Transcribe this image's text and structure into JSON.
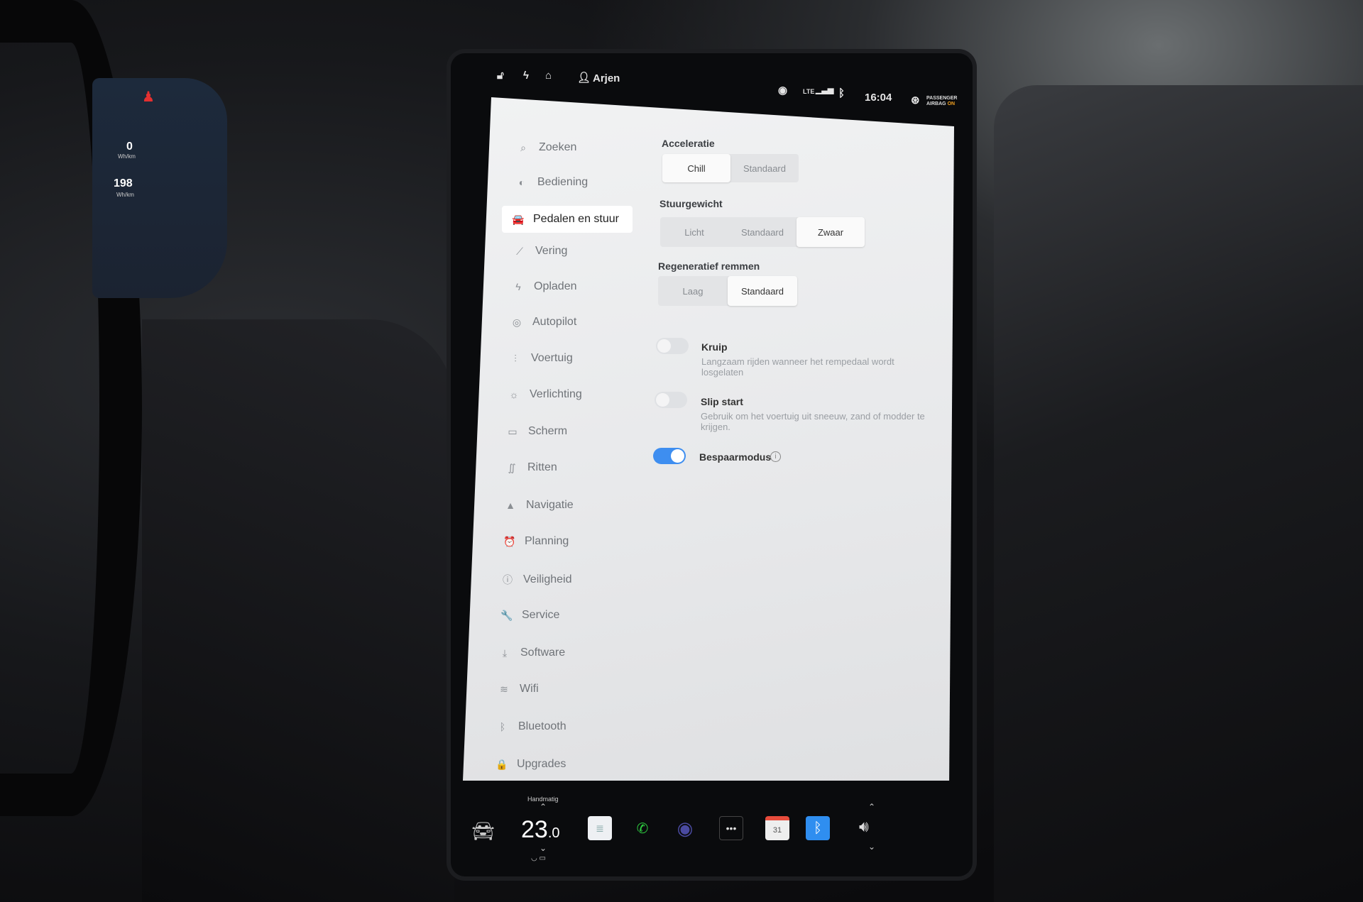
{
  "cluster": {
    "consumption_value": "0",
    "consumption_unit": "Wh/km",
    "avg_value": "198",
    "avg_unit": "Wh/km"
  },
  "status_bar": {
    "user": "Arjen",
    "network": "LTE",
    "time": "16:04",
    "airbag_line1": "PASSENGER",
    "airbag_line2": "AIRBAG",
    "airbag_state": "ON",
    "icons": [
      "lock-open-icon",
      "bolt-icon",
      "homelink-icon",
      "user-icon",
      "record-icon",
      "signal-icon",
      "bluetooth-icon",
      "airbag-icon"
    ]
  },
  "sidebar": {
    "items": [
      {
        "label": "Zoeken",
        "icon": "⌕"
      },
      {
        "label": "Bediening",
        "icon": "◐"
      },
      {
        "label": "Pedalen en stuur",
        "icon": "🚘",
        "selected": true
      },
      {
        "label": "Vering",
        "icon": "⟋"
      },
      {
        "label": "Opladen",
        "icon": "ϟ"
      },
      {
        "label": "Autopilot",
        "icon": "◎"
      },
      {
        "label": "Voertuig",
        "icon": "⫶"
      },
      {
        "label": "Verlichting",
        "icon": "☼"
      },
      {
        "label": "Scherm",
        "icon": "▭"
      },
      {
        "label": "Ritten",
        "icon": "∬"
      },
      {
        "label": "Navigatie",
        "icon": "▲"
      },
      {
        "label": "Planning",
        "icon": "⏰"
      },
      {
        "label": "Veiligheid",
        "icon": "ⓘ"
      },
      {
        "label": "Service",
        "icon": "🔧"
      },
      {
        "label": "Software",
        "icon": "⤓"
      },
      {
        "label": "Wifi",
        "icon": "≋"
      },
      {
        "label": "Bluetooth",
        "icon": "ᛒ"
      },
      {
        "label": "Upgrades",
        "icon": "🔒"
      }
    ]
  },
  "settings": {
    "acceleratie": {
      "label": "Acceleratie",
      "options": [
        "Chill",
        "Standaard"
      ],
      "selected": "Chill"
    },
    "stuurgewicht": {
      "label": "Stuurgewicht",
      "options": [
        "Licht",
        "Standaard",
        "Zwaar"
      ],
      "selected": "Zwaar"
    },
    "regen": {
      "label": "Regeneratief remmen",
      "options": [
        "Laag",
        "Standaard"
      ],
      "selected": "Standaard"
    },
    "kruip": {
      "title": "Kruip",
      "desc": "Langzaam rijden wanneer het rempedaal wordt losgelaten",
      "on": false
    },
    "slip": {
      "title": "Slip start",
      "desc": "Gebruik om het voertuig uit sneeuw, zand of modder te krijgen.",
      "on": false
    },
    "bespaar": {
      "title": "Bespaarmodus",
      "on": true
    }
  },
  "taskbar": {
    "climate_mode": "Handmatig",
    "temp_int": "23",
    "temp_dec": ".0",
    "calendar_day": "31",
    "colors": {
      "phone": "#2ecc40",
      "bluetooth": "#2f8ef0",
      "calendar": "#e74c3c",
      "toggle_on": "#3e8ef0"
    }
  }
}
